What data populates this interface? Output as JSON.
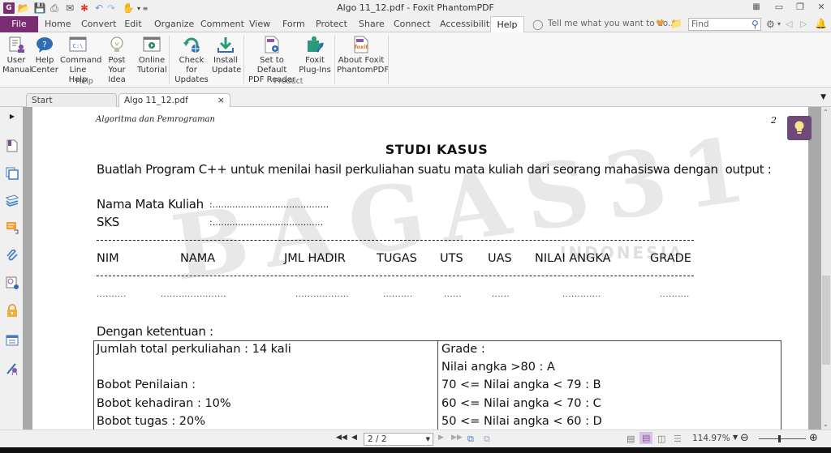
{
  "window": {
    "title": "Algo 11_12.pdf - Foxit PhantomPDF",
    "app_logo": "G"
  },
  "menu": {
    "tabs": [
      "File",
      "Home",
      "Convert",
      "Edit",
      "Organize",
      "Comment",
      "View",
      "Form",
      "Protect",
      "Share",
      "Connect",
      "Accessibility",
      "Help"
    ],
    "active_tab": "Help",
    "tell_me_placeholder": "Tell me what you want to do..",
    "find_placeholder": "Find"
  },
  "ribbon": {
    "help_group": {
      "label": "Help",
      "buttons": [
        {
          "line1": "User",
          "line2": "Manual",
          "icon": "user-manual-icon"
        },
        {
          "line1": "Help",
          "line2": "Center",
          "icon": "help-center-icon"
        },
        {
          "line1": "Command",
          "line2": "Line Help",
          "icon": "command-line-icon"
        },
        {
          "line1": "Post",
          "line2": "Your Idea",
          "icon": "lightbulb-icon"
        },
        {
          "line1": "Online",
          "line2": "Tutorial",
          "icon": "video-tutorial-icon"
        }
      ]
    },
    "update_group": {
      "buttons": [
        {
          "line1": "Check for",
          "line2": "Updates",
          "icon": "check-updates-icon"
        },
        {
          "line1": "Install",
          "line2": "Update",
          "icon": "download-icon"
        }
      ]
    },
    "product_group": {
      "label": "Product",
      "buttons": [
        {
          "line1": "Set to Default",
          "line2": "PDF Reader",
          "icon": "default-reader-icon"
        },
        {
          "line1": "Foxit",
          "line2": "Plug-Ins",
          "icon": "puzzle-icon"
        }
      ]
    },
    "about_group": {
      "buttons": [
        {
          "line1": "About Foxit",
          "line2": "PhantomPDF",
          "icon": "foxit-about-icon"
        }
      ]
    }
  },
  "doc_tabs": [
    {
      "label": "Start",
      "active": false
    },
    {
      "label": "Algo 11_12.pdf",
      "active": true,
      "close": "×"
    }
  ],
  "document": {
    "running_head": "Algoritma dan Pemrograman",
    "page_number": "2",
    "title": "STUDI KASUS",
    "intro": "Buatlah Program C++ untuk menilai hasil perkuliahan suatu mata kuliah dari seorang mahasiswa dengan  output :",
    "fields": [
      {
        "label": "Nama Mata Kuliah",
        "value": ":........................................."
      },
      {
        "label": "SKS",
        "value": ":......................................."
      }
    ],
    "columns": [
      "NIM",
      "NAMA",
      "JML HADIR",
      "TUGAS",
      "UTS",
      "UAS",
      "NILAI ANGKA",
      "GRADE"
    ],
    "placeholders": [
      "..........",
      "......................",
      "..................",
      "..........",
      "......",
      "......",
      ".............",
      ".........."
    ],
    "rules_heading": "Dengan ketentuan :",
    "rules_left": [
      "Jumlah total perkuliahan : 14 kali",
      "",
      "Bobot Penilaian :",
      "Bobot kehadiran : 10%",
      "Bobot tugas : 20%"
    ],
    "rules_right": [
      "Grade :",
      "Nilai angka >80 : A",
      "70 <= Nilai angka < 79 : B",
      "60 <= Nilai angka < 70 : C",
      "50 <= Nilai angka < 60 : D"
    ],
    "watermark": "BAGAS31",
    "watermark_sub": "INDONESIA"
  },
  "statusbar": {
    "page_indicator": "2 / 2",
    "zoom": "114.97%",
    "zoom_level_fraction": 0.43
  },
  "colors": {
    "brand": "#7b2d74",
    "tip_button": "#6e4a78"
  }
}
